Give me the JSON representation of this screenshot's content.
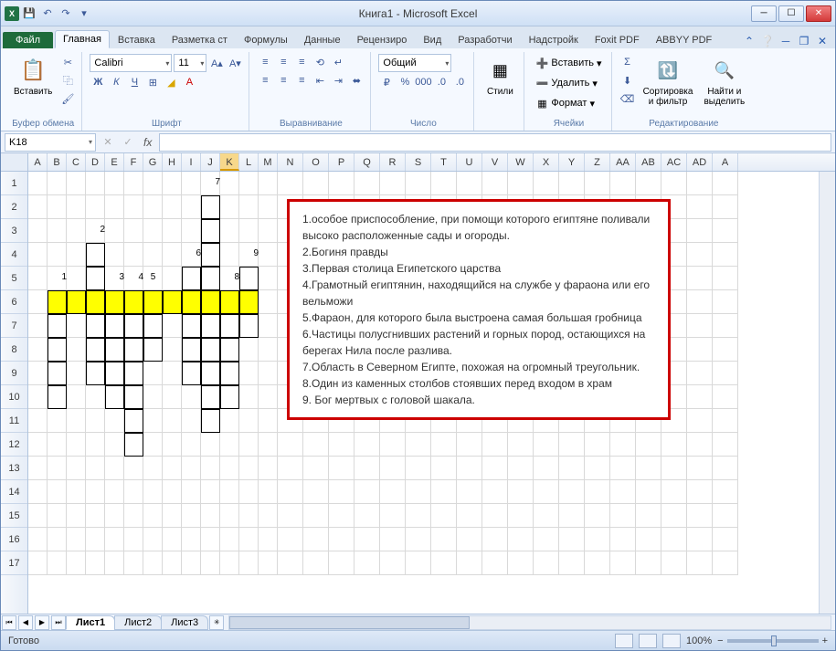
{
  "window": {
    "title": "Книга1 - Microsoft Excel"
  },
  "qat": {
    "save": "💾",
    "undo": "↶",
    "redo": "↷"
  },
  "tabs": {
    "file": "Файл",
    "items": [
      "Главная",
      "Вставка",
      "Разметка ст",
      "Формулы",
      "Данные",
      "Рецензиро",
      "Вид",
      "Разработчи",
      "Надстройк",
      "Foxit PDF",
      "ABBYY PDF"
    ],
    "active": 0
  },
  "ribbon": {
    "clipboard": {
      "paste": "Вставить",
      "label": "Буфер обмена"
    },
    "font": {
      "name": "Calibri",
      "size": "11",
      "label": "Шрифт"
    },
    "align": {
      "label": "Выравнивание"
    },
    "number": {
      "format": "Общий",
      "label": "Число"
    },
    "styles": {
      "btn": "Стили",
      "label": " "
    },
    "cells": {
      "insert": "Вставить",
      "delete": "Удалить",
      "format": "Формат",
      "label": "Ячейки"
    },
    "editing": {
      "sort": "Сортировка\nи фильтр",
      "find": "Найти и\nвыделить",
      "label": "Редактирование"
    }
  },
  "namebox": "K18",
  "fx": "fx",
  "columns": [
    "A",
    "B",
    "C",
    "D",
    "E",
    "F",
    "G",
    "H",
    "I",
    "J",
    "K",
    "L",
    "M",
    "N",
    "O",
    "P",
    "Q",
    "R",
    "S",
    "T",
    "U",
    "V",
    "W",
    "X",
    "Y",
    "Z",
    "AA",
    "AB",
    "AC",
    "AD",
    "A"
  ],
  "rows": [
    "1",
    "2",
    "3",
    "4",
    "5",
    "6",
    "7",
    "8",
    "9",
    "10",
    "11",
    "12",
    "13",
    "14",
    "15",
    "16",
    "17"
  ],
  "colwidths": {
    "narrow": 21,
    "N_start_wide": 28
  },
  "crossword": {
    "labels": [
      {
        "text": "7",
        "col": "J",
        "row": 1,
        "align": "right"
      },
      {
        "text": "2",
        "col": "D",
        "row": 3,
        "align": "right"
      },
      {
        "text": "6",
        "col": "I",
        "row": 4,
        "align": "right"
      },
      {
        "text": "9",
        "col": "L",
        "row": 4,
        "align": "right"
      },
      {
        "text": "1",
        "col": "B",
        "row": 5,
        "align": "right"
      },
      {
        "text": "3",
        "col": "E",
        "row": 5,
        "align": "right"
      },
      {
        "text": "4",
        "col": "F",
        "row": 5,
        "align": "right"
      },
      {
        "text": "5",
        "col": "G",
        "row": 5,
        "align": "center"
      },
      {
        "text": "8",
        "col": "K",
        "row": 5,
        "align": "right"
      }
    ],
    "cells": [
      [
        "J",
        2
      ],
      [
        "J",
        3
      ],
      [
        "J",
        4
      ],
      [
        "J",
        5
      ],
      [
        "D",
        4
      ],
      [
        "D",
        5
      ],
      [
        "I",
        5
      ],
      [
        "L",
        5
      ],
      [
        "B",
        6,
        "y"
      ],
      [
        "C",
        6,
        "y"
      ],
      [
        "D",
        6,
        "y"
      ],
      [
        "E",
        6,
        "y"
      ],
      [
        "F",
        6,
        "y"
      ],
      [
        "G",
        6,
        "y"
      ],
      [
        "H",
        6,
        "y"
      ],
      [
        "I",
        6,
        "y"
      ],
      [
        "J",
        6,
        "y"
      ],
      [
        "K",
        6,
        "y"
      ],
      [
        "L",
        6,
        "y"
      ],
      [
        "B",
        7
      ],
      [
        "D",
        7
      ],
      [
        "E",
        7
      ],
      [
        "F",
        7
      ],
      [
        "G",
        7
      ],
      [
        "I",
        7
      ],
      [
        "J",
        7
      ],
      [
        "K",
        7
      ],
      [
        "L",
        7
      ],
      [
        "B",
        8
      ],
      [
        "D",
        8
      ],
      [
        "E",
        8
      ],
      [
        "F",
        8
      ],
      [
        "G",
        8
      ],
      [
        "I",
        8
      ],
      [
        "J",
        8
      ],
      [
        "K",
        8
      ],
      [
        "B",
        9
      ],
      [
        "D",
        9
      ],
      [
        "E",
        9
      ],
      [
        "F",
        9
      ],
      [
        "I",
        9
      ],
      [
        "J",
        9
      ],
      [
        "K",
        9
      ],
      [
        "B",
        10
      ],
      [
        "E",
        10
      ],
      [
        "F",
        10
      ],
      [
        "J",
        10
      ],
      [
        "K",
        10
      ],
      [
        "F",
        11
      ],
      [
        "J",
        11
      ],
      [
        "F",
        12
      ]
    ]
  },
  "clues": [
    "1.особое приспособление, при помощи которого египтяне поливали высоко расположенные сады и огороды.",
    "2.Богиня правды",
    "3.Первая столица Египетского царства",
    "4.Грамотный египтянин, находящийся на службе у фараона или его вельможи",
    "5.Фараон, для которого была выстроена самая большая гробница",
    "6.Частицы полусгнивших растений и горных пород, остающихся на берегах Нила после разлива.",
    "7.Область в Северном Египте, похожая на огромный треугольник.",
    "8.Один из каменных столбов стоявших перед входом в храм",
    "9. Бог мертвых с головой шакала."
  ],
  "sheets": {
    "items": [
      "Лист1",
      "Лист2",
      "Лист3"
    ],
    "active": 0
  },
  "status": {
    "ready": "Готово",
    "zoom": "100%"
  },
  "selected_cell": {
    "col": "K",
    "row": 18
  }
}
